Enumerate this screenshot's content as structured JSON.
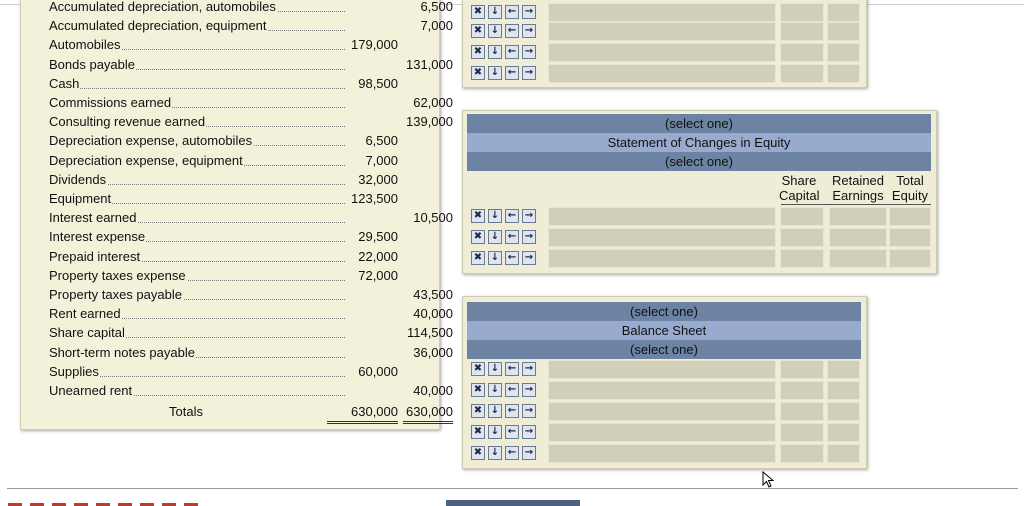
{
  "trial_balance": {
    "rows": [
      {
        "name": "Accumulated depreciation, automobiles",
        "debit": "",
        "credit": "6,500"
      },
      {
        "name": "Accumulated depreciation, equipment",
        "debit": "",
        "credit": "7,000"
      },
      {
        "name": "Automobiles",
        "debit": "179,000",
        "credit": ""
      },
      {
        "name": "Bonds payable",
        "debit": "",
        "credit": "131,000"
      },
      {
        "name": "Cash",
        "debit": "98,500",
        "credit": ""
      },
      {
        "name": "Commissions earned",
        "debit": "",
        "credit": "62,000"
      },
      {
        "name": "Consulting revenue earned",
        "debit": "",
        "credit": "139,000"
      },
      {
        "name": "Depreciation expense, automobiles",
        "debit": "6,500",
        "credit": ""
      },
      {
        "name": "Depreciation expense, equipment",
        "debit": "7,000",
        "credit": ""
      },
      {
        "name": "Dividends",
        "debit": "32,000",
        "credit": ""
      },
      {
        "name": "Equipment",
        "debit": "123,500",
        "credit": ""
      },
      {
        "name": "Interest earned",
        "debit": "",
        "credit": "10,500"
      },
      {
        "name": "Interest expense",
        "debit": "29,500",
        "credit": ""
      },
      {
        "name": "Prepaid interest",
        "debit": "22,000",
        "credit": ""
      },
      {
        "name": "Property taxes expense",
        "debit": "72,000",
        "credit": ""
      },
      {
        "name": "Property taxes payable",
        "debit": "",
        "credit": "43,500"
      },
      {
        "name": "Rent earned",
        "debit": "",
        "credit": "40,000"
      },
      {
        "name": "Share capital",
        "debit": "",
        "credit": "114,500"
      },
      {
        "name": "Short-term notes payable",
        "debit": "",
        "credit": "36,000"
      },
      {
        "name": "Supplies",
        "debit": "60,000",
        "credit": ""
      },
      {
        "name": "Unearned rent",
        "debit": "",
        "credit": "40,000"
      }
    ],
    "totals_label": "Totals",
    "total_debit": "630,000",
    "total_credit": "630,000"
  },
  "row_controls": {
    "delete": "✖",
    "insert": "↓",
    "outdent": "←",
    "indent": "→"
  },
  "equity_statement": {
    "line1": "(select one)",
    "title": "Statement of Changes in Equity",
    "line3": "(select one)",
    "col_share_1": "Share",
    "col_share_2": "Capital",
    "col_retained_1": "Retained",
    "col_retained_2": "Earnings",
    "col_total_1": "Total",
    "col_total_2": "Equity"
  },
  "balance_sheet": {
    "line1": "(select one)",
    "title": "Balance Sheet",
    "line3": "(select one)"
  }
}
